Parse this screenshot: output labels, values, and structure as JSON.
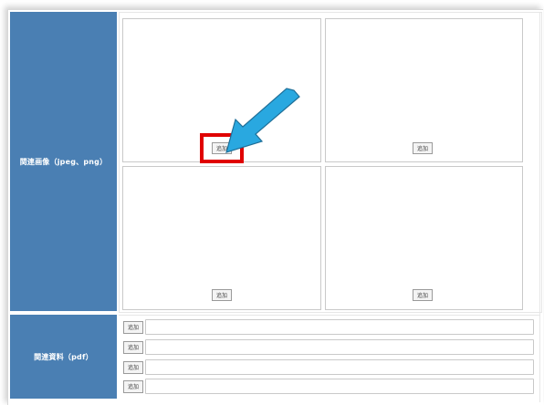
{
  "form": {
    "images_label": "関連画像（jpeg、png）",
    "pdf_label": "関連資料（pdf）",
    "image_slots": [
      {
        "add_label": "追加"
      },
      {
        "add_label": "追加"
      },
      {
        "add_label": "追加"
      },
      {
        "add_label": "追加"
      }
    ],
    "pdf_rows": [
      {
        "add_label": "追加",
        "value": ""
      },
      {
        "add_label": "追加",
        "value": ""
      },
      {
        "add_label": "追加",
        "value": ""
      },
      {
        "add_label": "追加",
        "value": ""
      }
    ]
  },
  "annotation": {
    "highlight_color": "#e00000",
    "arrow_color": "#29a8e0",
    "target": "image_slots.0.add_label"
  },
  "colors": {
    "label_bg": "#4a7fb3",
    "label_text": "#ffffff",
    "border": "#c9c9c9"
  }
}
